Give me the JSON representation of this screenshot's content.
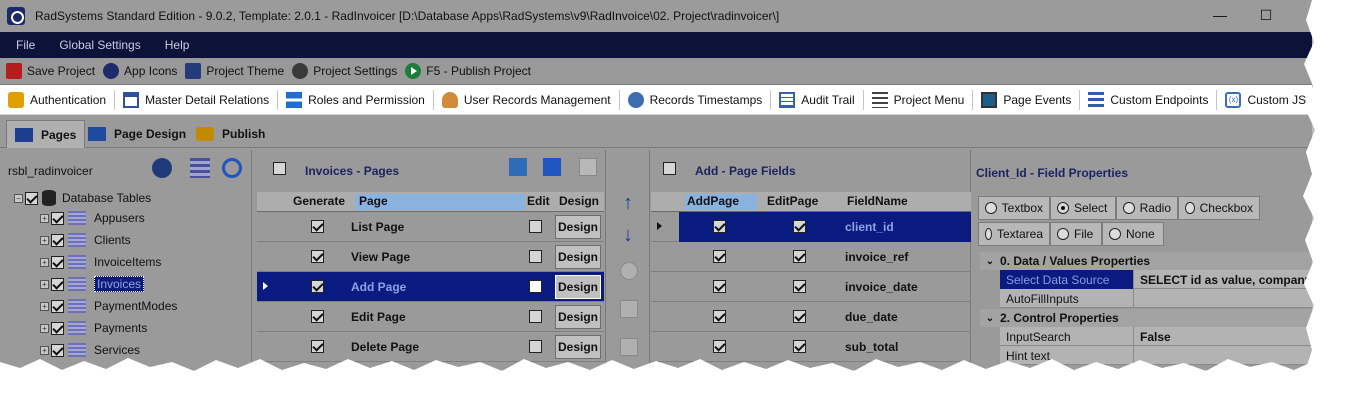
{
  "window": {
    "title": "RadSystems Standard Edition - 9.0.2, Template: 2.0.1 - RadInvoicer [D:\\Database Apps\\RadSystems\\v9\\RadInvoice\\02. Project\\radinvoicer\\]",
    "minimize": "—",
    "maximize": "☐"
  },
  "menubar": [
    "File",
    "Global Settings",
    "Help"
  ],
  "toolbar": {
    "save": "Save Project",
    "app_icons": "App Icons",
    "theme": "Project Theme",
    "settings": "Project Settings",
    "publish": "F5 - Publish Project"
  },
  "features": [
    "Authentication",
    "Master Detail Relations",
    "Roles and Permission",
    "User Records Management",
    "Records Timestamps",
    "Audit Trail",
    "Project Menu",
    "Page Events",
    "Custom Endpoints",
    "Custom JS"
  ],
  "tabs": [
    "Pages",
    "Page Design",
    "Publish"
  ],
  "tree": {
    "project": "rsbl_radinvoicer",
    "root": "Database Tables",
    "tables": [
      "Appusers",
      "Clients",
      "InvoiceItems",
      "Invoices",
      "PaymentModes",
      "Payments",
      "Services"
    ],
    "selected": "Invoices"
  },
  "pages_pane": {
    "title": "Invoices - Pages",
    "headers": {
      "generate": "Generate",
      "page": "Page",
      "edit": "Edit",
      "design": "Design"
    },
    "rows": [
      {
        "page": "List Page",
        "generate": true,
        "edit": false,
        "design": "Design"
      },
      {
        "page": "View Page",
        "generate": true,
        "edit": false,
        "design": "Design"
      },
      {
        "page": "Add Page",
        "generate": true,
        "edit": false,
        "design": "Design",
        "selected": true
      },
      {
        "page": "Edit Page",
        "generate": true,
        "edit": false,
        "design": "Design"
      },
      {
        "page": "Delete Page",
        "generate": true,
        "edit": false,
        "design": "Design"
      }
    ]
  },
  "fields_pane": {
    "title": "Add - Page Fields",
    "headers": {
      "addpage": "AddPage",
      "editpage": "EditPage",
      "fieldname": "FieldName"
    },
    "rows": [
      {
        "field": "client_id",
        "add": true,
        "edit": true,
        "selected": true
      },
      {
        "field": "invoice_ref",
        "add": true,
        "edit": true
      },
      {
        "field": "invoice_date",
        "add": true,
        "edit": true
      },
      {
        "field": "due_date",
        "add": true,
        "edit": true
      },
      {
        "field": "sub_total",
        "add": true,
        "edit": true
      }
    ]
  },
  "props_pane": {
    "title": "Client_Id - Field Properties",
    "controls_row1": [
      "Textbox",
      "Select",
      "Radio",
      "Checkbox"
    ],
    "controls_row2": [
      "Textarea",
      "File",
      "None"
    ],
    "selected_control": "Select",
    "section1": "0. Data / Values Properties",
    "section1_rows": [
      {
        "key": "Select Data Source",
        "value": "SELECT id as value, company_na",
        "selected": true
      },
      {
        "key": "AutoFillInputs",
        "value": ""
      }
    ],
    "section2": "2. Control Properties",
    "section2_rows": [
      {
        "key": "InputSearch",
        "value": "False"
      },
      {
        "key": "Hint text",
        "value": ""
      }
    ]
  }
}
